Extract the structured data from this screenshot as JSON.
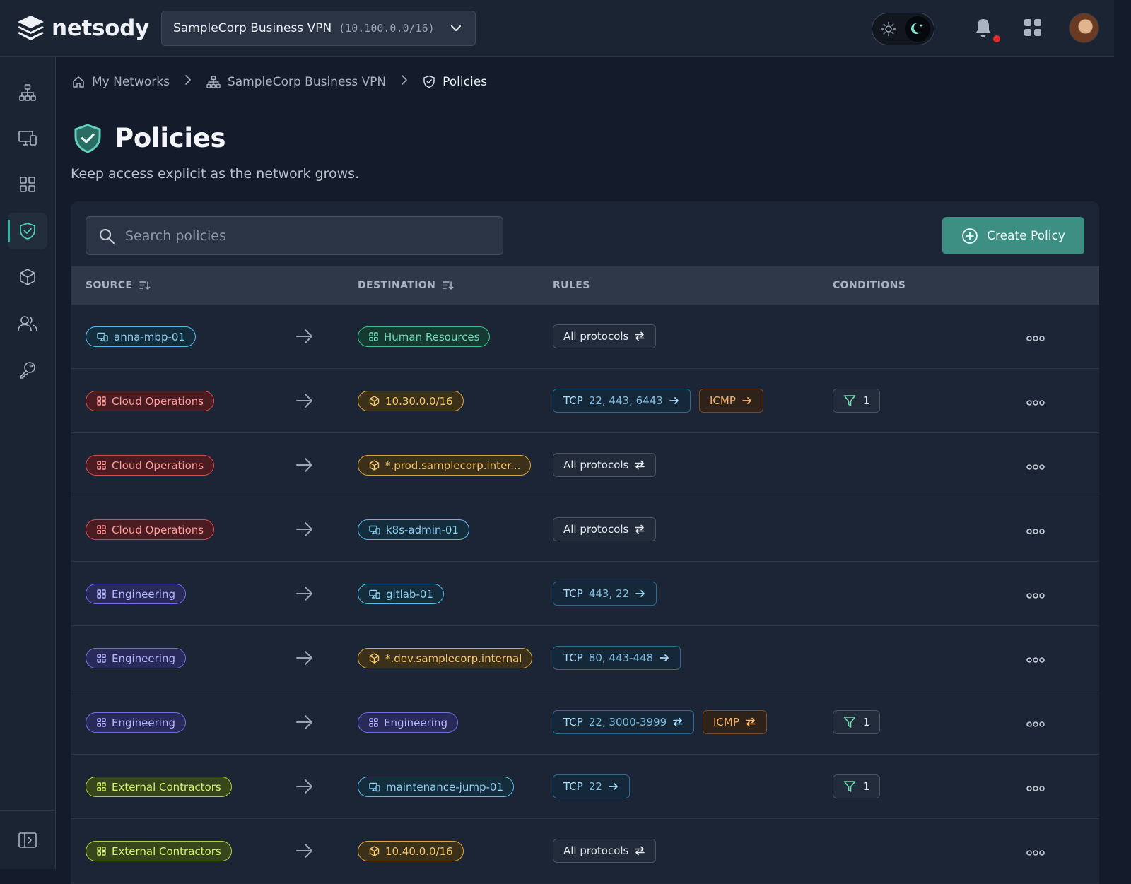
{
  "app": {
    "logo_text": "netsody",
    "network_name": "SampleCorp Business VPN",
    "network_cidr": "(10.100.0.0/16)"
  },
  "breadcrumb": {
    "home": "My Networks",
    "network": "SampleCorp Business VPN",
    "current": "Policies"
  },
  "page": {
    "title": "Policies",
    "subtitle": "Keep access explicit as the network grows."
  },
  "toolbar": {
    "search_placeholder": "Search policies",
    "create_label": "Create Policy"
  },
  "table": {
    "headers": {
      "source": "SOURCE",
      "destination": "DESTINATION",
      "rules": "RULES",
      "conditions": "CONDITIONS"
    },
    "rows": [
      {
        "source": {
          "label": "anna-mbp-01",
          "kind": "device",
          "color": "#5fb9e6"
        },
        "destination": {
          "label": "Human Resources",
          "kind": "group",
          "color": "#3fbf8f"
        },
        "rules": [
          {
            "type": "all",
            "label": "All protocols",
            "dir": "bidirectional"
          }
        ],
        "conditions": ""
      },
      {
        "source": {
          "label": "Cloud Operations",
          "kind": "group",
          "color": "#d84b4b"
        },
        "destination": {
          "label": "10.30.0.0/16",
          "kind": "resource",
          "color": "#d8a53f"
        },
        "rules": [
          {
            "type": "tcp",
            "label": "TCP",
            "ports": "22, 443, 6443",
            "dir": "outbound"
          },
          {
            "type": "icmp",
            "label": "ICMP",
            "dir": "outbound"
          }
        ],
        "conditions": "1"
      },
      {
        "source": {
          "label": "Cloud Operations",
          "kind": "group",
          "color": "#d84b4b"
        },
        "destination": {
          "label": "*.prod.samplecorp.inter...",
          "kind": "resource",
          "color": "#d8a53f"
        },
        "rules": [
          {
            "type": "all",
            "label": "All protocols",
            "dir": "bidirectional"
          }
        ],
        "conditions": ""
      },
      {
        "source": {
          "label": "Cloud Operations",
          "kind": "group",
          "color": "#d84b4b"
        },
        "destination": {
          "label": "k8s-admin-01",
          "kind": "device",
          "color": "#5fb9e6"
        },
        "rules": [
          {
            "type": "all",
            "label": "All protocols",
            "dir": "bidirectional"
          }
        ],
        "conditions": ""
      },
      {
        "source": {
          "label": "Engineering",
          "kind": "group",
          "color": "#6d6ee6"
        },
        "destination": {
          "label": "gitlab-01",
          "kind": "device",
          "color": "#5fb9e6"
        },
        "rules": [
          {
            "type": "tcp",
            "label": "TCP",
            "ports": "443, 22",
            "dir": "outbound"
          }
        ],
        "conditions": ""
      },
      {
        "source": {
          "label": "Engineering",
          "kind": "group",
          "color": "#6d6ee6"
        },
        "destination": {
          "label": "*.dev.samplecorp.internal",
          "kind": "resource",
          "color": "#d8a53f"
        },
        "rules": [
          {
            "type": "tcp",
            "label": "TCP",
            "ports": "80, 443-448",
            "dir": "outbound"
          }
        ],
        "conditions": ""
      },
      {
        "source": {
          "label": "Engineering",
          "kind": "group",
          "color": "#6d6ee6"
        },
        "destination": {
          "label": "Engineering",
          "kind": "group",
          "color": "#6d6ee6"
        },
        "rules": [
          {
            "type": "tcp",
            "label": "TCP",
            "ports": "22, 3000-3999",
            "dir": "bidirectional"
          },
          {
            "type": "icmp",
            "label": "ICMP",
            "dir": "bidirectional"
          }
        ],
        "conditions": "1"
      },
      {
        "source": {
          "label": "External Contractors",
          "kind": "group",
          "color": "#a9d33a"
        },
        "destination": {
          "label": "maintenance-jump-01",
          "kind": "device",
          "color": "#5fb9e6"
        },
        "rules": [
          {
            "type": "tcp",
            "label": "TCP",
            "ports": "22",
            "dir": "outbound"
          }
        ],
        "conditions": "1"
      },
      {
        "source": {
          "label": "External Contractors",
          "kind": "group",
          "color": "#a9d33a"
        },
        "destination": {
          "label": "10.40.0.0/16",
          "kind": "resource",
          "color": "#d8a53f"
        },
        "rules": [
          {
            "type": "all",
            "label": "All protocols",
            "dir": "bidirectional"
          }
        ],
        "conditions": ""
      }
    ]
  },
  "sidebar": {
    "items": [
      {
        "icon": "network-topology-icon",
        "active": false
      },
      {
        "icon": "devices-icon",
        "active": false
      },
      {
        "icon": "groups-grid-icon",
        "active": false
      },
      {
        "icon": "shield-check-icon",
        "active": true
      },
      {
        "icon": "resource-cube-icon",
        "active": false
      },
      {
        "icon": "users-icon",
        "active": false
      },
      {
        "icon": "key-icon",
        "active": false
      }
    ]
  },
  "theme": {
    "mode": "dark",
    "accent": "#3d8f83"
  }
}
